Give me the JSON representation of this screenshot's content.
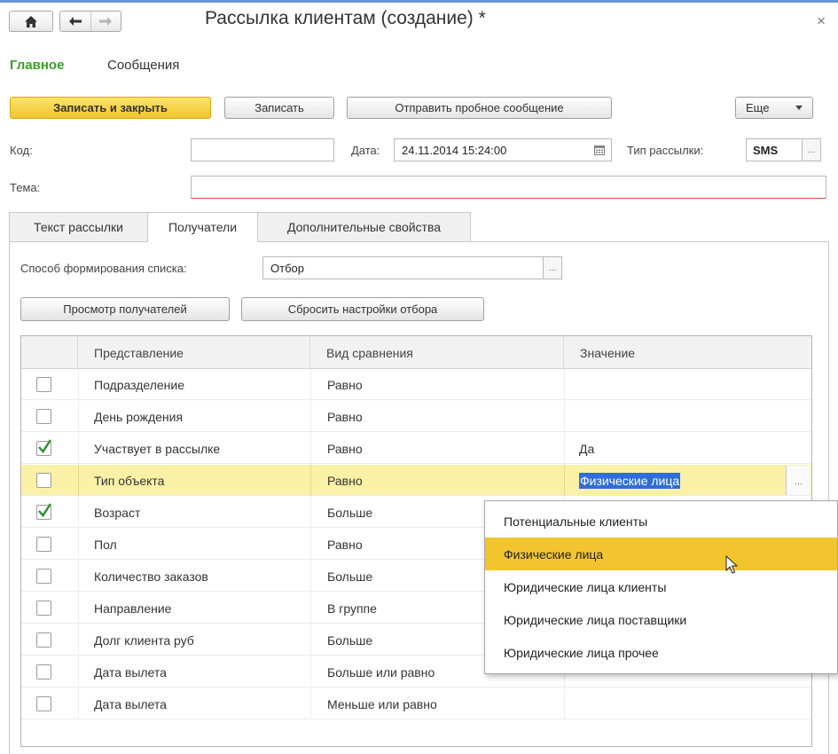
{
  "window": {
    "title": "Рассылка клиентам (создание) *",
    "close_glyph": "×"
  },
  "sections": {
    "main": "Главное",
    "messages": "Сообщения"
  },
  "toolbar": {
    "save_close": "Записать и закрыть",
    "save": "Записать",
    "send_test": "Отправить пробное сообщение",
    "more": "Еще"
  },
  "form": {
    "code_label": "Код:",
    "code_value": "",
    "date_label": "Дата:",
    "date_value": "24.11.2014 15:24:00",
    "type_label": "Тип рассылки:",
    "type_value": "SMS",
    "subject_label": "Тема:",
    "subject_value": ""
  },
  "tabs": [
    {
      "label": "Текст рассылки"
    },
    {
      "label": "Получатели"
    },
    {
      "label": "Дополнительные свойства"
    }
  ],
  "recipients": {
    "method_label": "Способ формирования списка:",
    "method_value": "Отбор",
    "view_button": "Просмотр получателей",
    "reset_button": "Сбросить настройки отбора"
  },
  "filter_table": {
    "columns": [
      "Представление",
      "Вид сравнения",
      "Значение"
    ],
    "rows": [
      {
        "checked": false,
        "field": "Подразделение",
        "comparison": "Равно",
        "value": ""
      },
      {
        "checked": false,
        "field": "День рождения",
        "comparison": "Равно",
        "value": ""
      },
      {
        "checked": true,
        "field": "Участвует в рассылке",
        "comparison": "Равно",
        "value": "Да"
      },
      {
        "checked": false,
        "field": "Тип объекта",
        "comparison": "Равно",
        "value": "Физические лица"
      },
      {
        "checked": true,
        "field": "Возраст",
        "comparison": "Больше",
        "value": ""
      },
      {
        "checked": false,
        "field": "Пол",
        "comparison": "Равно",
        "value": ""
      },
      {
        "checked": false,
        "field": "Количество заказов",
        "comparison": "Больше",
        "value": ""
      },
      {
        "checked": false,
        "field": "Направление",
        "comparison": "В группе",
        "value": ""
      },
      {
        "checked": false,
        "field": "Долг клиента руб",
        "comparison": "Больше",
        "value": ""
      },
      {
        "checked": false,
        "field": "Дата вылета",
        "comparison": "Больше или равно",
        "value": ""
      },
      {
        "checked": false,
        "field": "Дата вылета",
        "comparison": "Меньше или равно",
        "value": ""
      }
    ]
  },
  "dropdown": {
    "options": [
      "Потенциальные клиенты",
      "Физические лица",
      "Юридические лица клиенты",
      "Юридические лица поставщики",
      "Юридические лица прочее"
    ],
    "selected_index": 1
  },
  "icons": {
    "home": "home-icon",
    "back": "arrow-left-icon",
    "forward": "arrow-right-icon",
    "calendar": "calendar-icon",
    "check": "checkmark-icon",
    "more": "chevron-down-icon",
    "select": "ellipsis-icon"
  },
  "colors": {
    "primary_button": "#f2c52e",
    "active_section": "#3b9d26",
    "row_highlight": "#fbf1a6",
    "selection": "#2f6ed8",
    "checkmark": "#2e8b2e"
  }
}
